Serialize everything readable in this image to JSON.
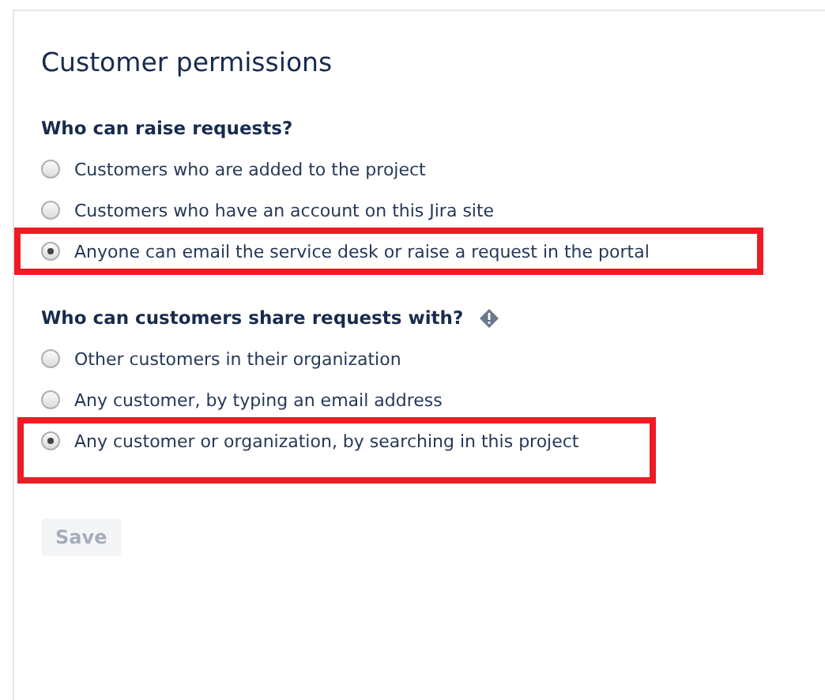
{
  "title": "Customer permissions",
  "groups": [
    {
      "heading": "Who can raise requests?",
      "info": false,
      "options": [
        {
          "label": "Customers who are added to the project",
          "selected": false,
          "highlighted": false
        },
        {
          "label": "Customers who have an account on this Jira site",
          "selected": false,
          "highlighted": false
        },
        {
          "label": "Anyone can email the service desk or raise a request in the portal",
          "selected": true,
          "highlighted": true
        }
      ]
    },
    {
      "heading": "Who can customers share requests with?",
      "info": true,
      "options": [
        {
          "label": "Other customers in their organization",
          "selected": false,
          "highlighted": false
        },
        {
          "label": "Any customer, by typing an email address",
          "selected": false,
          "highlighted": false
        },
        {
          "label": "Any customer or organization, by searching in this project",
          "selected": true,
          "highlighted": true
        }
      ]
    }
  ],
  "save": {
    "label": "Save",
    "disabled": true
  }
}
